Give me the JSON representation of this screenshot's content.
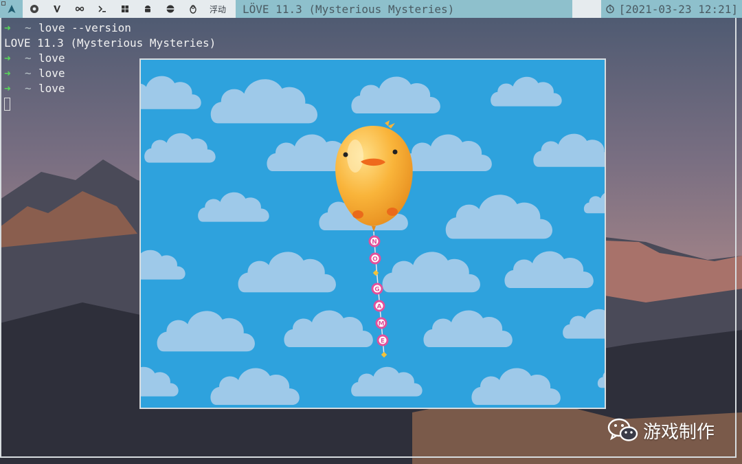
{
  "topbar": {
    "workspaces": [
      {
        "icon": "arch-icon",
        "active": true
      },
      {
        "icon": "chrome-icon"
      },
      {
        "icon": "vim-icon"
      },
      {
        "icon": "infinity-icon"
      },
      {
        "icon": "terminal-prompt-icon"
      },
      {
        "icon": "windows-icon"
      },
      {
        "icon": "android-icon"
      },
      {
        "icon": "disc-icon"
      },
      {
        "icon": "linux-penguin-icon"
      },
      {
        "label": "浮动"
      }
    ],
    "window_title": "LÖVE 11.3 (Mysterious Mysteries)",
    "clock": "[2021-03-23 12:21]",
    "clock_icon": "clock-icon"
  },
  "terminal": {
    "lines": [
      {
        "prompt": true,
        "text": "love --version"
      },
      {
        "prompt": false,
        "text": "LOVE 11.3 (Mysterious Mysteries)"
      },
      {
        "prompt": true,
        "text": "love"
      },
      {
        "prompt": true,
        "text": "love"
      },
      {
        "prompt": true,
        "text": "love"
      }
    ],
    "prompt_arrow": "➜",
    "prompt_dir": "~"
  },
  "game": {
    "balloon_string_letters": [
      "N",
      "O",
      "G",
      "A",
      "M",
      "E"
    ],
    "colors": {
      "sky": "#2ea2dd",
      "cloud": "#9ec9e9",
      "balloon": "#f7a52d",
      "letter_bead": "#e2509b"
    }
  },
  "watermark": {
    "icon": "wechat-icon",
    "text": "游戏制作"
  },
  "colors": {
    "statusbar_bg": "#e6ebee",
    "statusbar_accent": "#8ec0cc",
    "prompt_green": "#58d858"
  }
}
